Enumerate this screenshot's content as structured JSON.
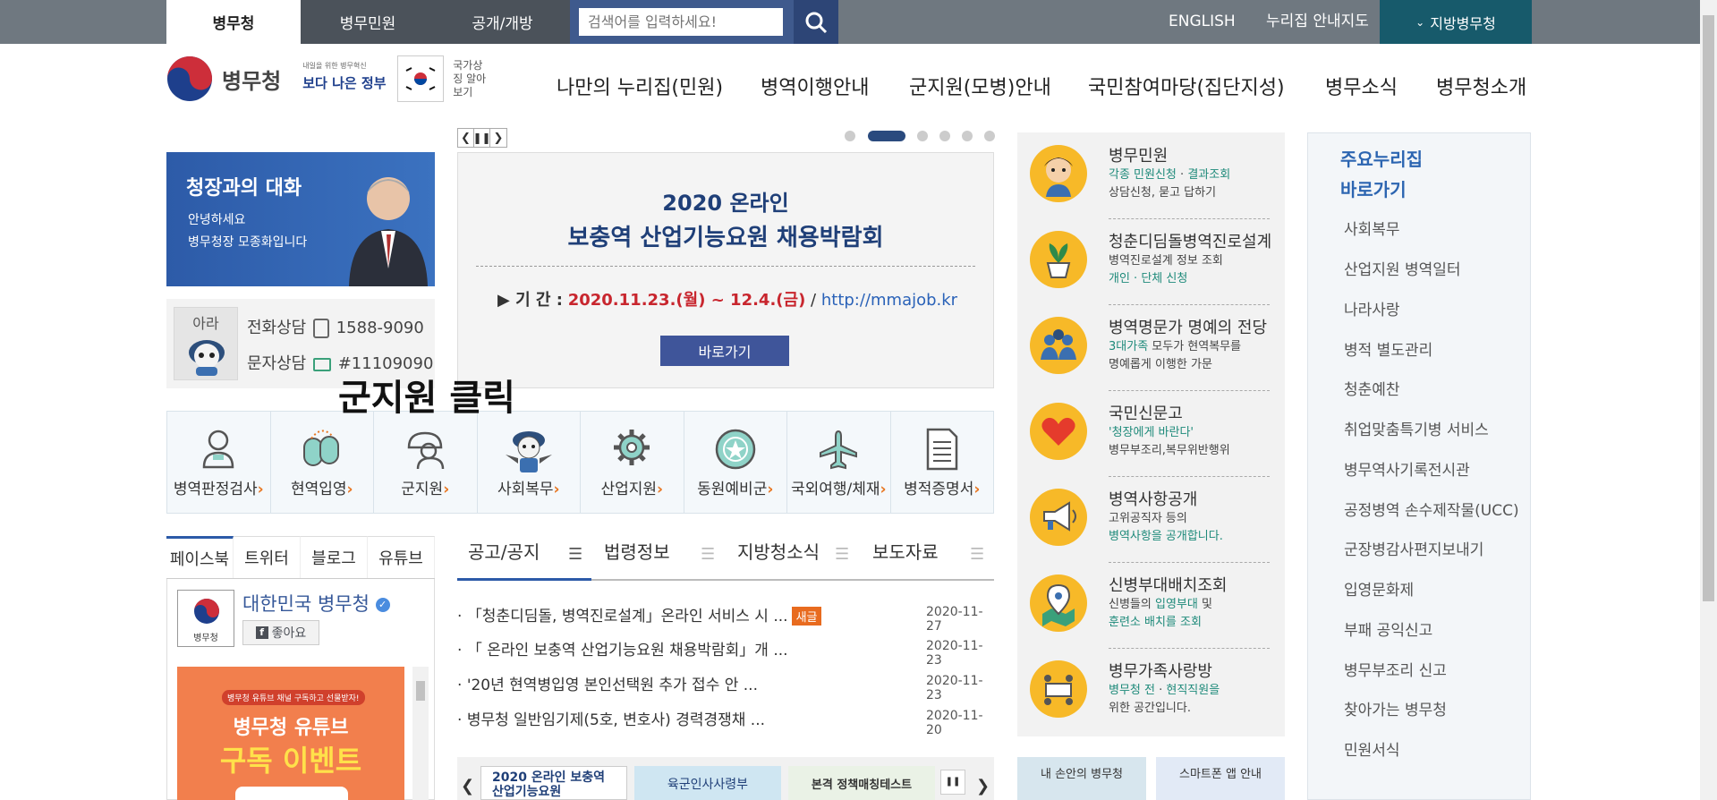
{
  "topbar": {
    "tabs": [
      "병무청",
      "병무민원",
      "공개/개방"
    ],
    "search_placeholder": "검색어를 입력하세요!",
    "english": "ENGLISH",
    "guide": "누리집 안내지도",
    "regional": "지방병무청"
  },
  "logo": {
    "org": "병무청",
    "slogan_small": "내일을 위한 병무혁신",
    "slogan": "보다 나은 정부",
    "symbol_label": "국가상징 알아보기"
  },
  "gnb": [
    "나만의 누리집(민원)",
    "병역이행안내",
    "군지원(모병)안내",
    "국민참여마당(집단지성)",
    "병무소식",
    "병무청소개"
  ],
  "commissioner": {
    "title": "청장과의 대화",
    "line1": "안녕하세요",
    "line2": "병무청장 모종화입니다"
  },
  "contact": {
    "mascot": "아라",
    "phone_label": "전화상담",
    "phone": "1588-9090",
    "sms_label": "문자상담",
    "sms": "#11109090"
  },
  "banner": {
    "title1": "2020 온라인",
    "title2": "보충역 산업기능요원 채용박람회",
    "period_label": "▶ 기 간 :",
    "period": "2020.11.23.(월) ~ 12.4.(금)",
    "sep": "/",
    "url": "http://mmajob.kr",
    "button": "바로가기"
  },
  "overlay": "군지원 클릭",
  "icons": [
    "병역판정검사",
    "현역입영",
    "군지원",
    "사회복무",
    "산업지원",
    "동원예비군",
    "국외여행/체재",
    "병적증명서"
  ],
  "sns": {
    "tabs": [
      "페이스북",
      "트위터",
      "블로그",
      "유튜브"
    ],
    "page_name": "대한민국 병무청",
    "like": "좋아요",
    "avatar_label": "병무청",
    "promo_top": "병무청 유튜브 채널 구독하고 선물받자!",
    "promo1": "병무청 유튜브",
    "promo2": "구독 이벤트"
  },
  "news": {
    "tabs": [
      "공고/공지",
      "법령정보",
      "지방청소식",
      "보도자료"
    ],
    "items": [
      {
        "text": "「청춘디딤돌, 병역진로설계」온라인 서비스 시 ...",
        "badge": "새글",
        "date": "2020-11-27"
      },
      {
        "text": "「 온라인 보충역 산업기능요원 채용박람회」개 ...",
        "badge": "",
        "date": "2020-11-23"
      },
      {
        "text": "'20년 현역병입영 본인선택원 추가 접수 안 ...",
        "badge": "",
        "date": "2020-11-23"
      },
      {
        "text": "병무청 일반임기제(5호, 변호사) 경력경쟁채 ...",
        "badge": "",
        "date": "2020-11-20"
      }
    ]
  },
  "thumbs": [
    "2020 온라인 보충역 산업기능요원",
    "육군인사사령부",
    "본격 정책매칭테스트"
  ],
  "services": [
    {
      "title": "병무민원",
      "l1a": "각종 민원신청",
      "l1b": " · ",
      "l1c": "결과조회",
      "l2": "상담신청, 묻고 답하기"
    },
    {
      "title": "청춘디딤돌병역진로설계",
      "l1a": "병역진로설계 정보 조회",
      "l1b": "",
      "l1c": "",
      "l2": "개인 · 단체 신청"
    },
    {
      "title": "병역명문가 명예의 전당",
      "l1a": "3대가족",
      "l1b": " 모두가 현역복무를",
      "l1c": "",
      "l2": "명예롭게 이행한 가문"
    },
    {
      "title": "국민신문고",
      "l1a": "'청장에게 바란다'",
      "l1b": "",
      "l1c": "",
      "l2": "병무부조리,복무위반행위"
    },
    {
      "title": "병역사항공개",
      "l1a": "고위공직자 등의",
      "l1b": "",
      "l1c": "",
      "l2": "병역사항을 공개합니다."
    },
    {
      "title": "신병부대배치조회",
      "l1a": "신병들의 ",
      "l1b": "입영부대",
      "l1c": " 및",
      "l2": "훈련소 배치를 조회"
    },
    {
      "title": "병무가족사랑방",
      "l1a": "병무청 전",
      "l1b": " · ",
      "l1c": "현직직원을",
      "l2": "위한 공간입니다."
    }
  ],
  "tiles": [
    "내 손안의 병무청",
    "스마트폰 앱 안내"
  ],
  "quick": {
    "head1": "주요누리집",
    "head2": "바로가기",
    "items": [
      "사회복무",
      "산업지원 병역일터",
      "나라사랑",
      "병적 별도관리",
      "청춘예찬",
      "취업맞춤특기병 서비스",
      "병무역사기록전시관",
      "공정병역 손수제작물(UCC)",
      "군장병감사편지보내기",
      "입영문화제",
      "부패 공익신고",
      "병무부조리 신고",
      "찾아가는 병무청",
      "민원서식"
    ]
  }
}
